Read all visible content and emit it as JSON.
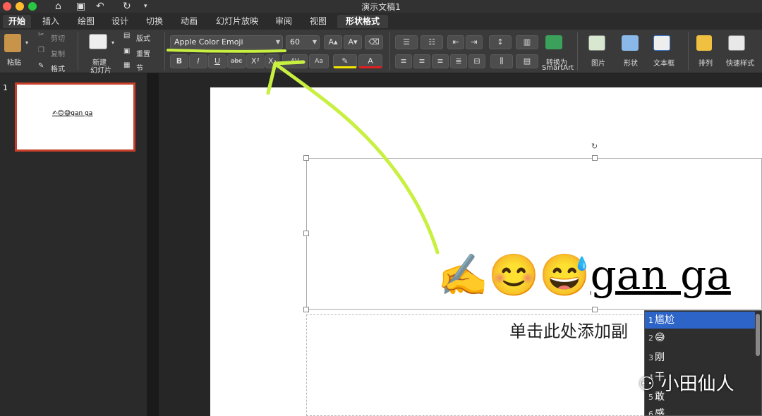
{
  "window": {
    "title": "演示文稿1"
  },
  "tabs": [
    "开始",
    "插入",
    "绘图",
    "设计",
    "切换",
    "动画",
    "幻灯片放映",
    "审阅",
    "视图",
    "形状格式"
  ],
  "ribbon": {
    "paste": "粘贴",
    "cut": "剪切",
    "copy": "复制",
    "format_painter": "格式",
    "new_slide_line1": "新建",
    "new_slide_line2": "幻灯片",
    "layout": "版式",
    "reset": "重置",
    "section": "节",
    "font_name": "Apple Color Emoji",
    "font_size": "60",
    "bold": "B",
    "italic": "I",
    "underline": "U",
    "strike": "abc",
    "superscript": "X²",
    "subscript": "X₂",
    "char_spacing": "AV",
    "change_case": "Aa",
    "font_color_letter": "A",
    "smartart_line1": "转换为",
    "smartart_line2": "SmartArt",
    "picture": "图片",
    "shapes": "形状",
    "textbox": "文本框",
    "arrange": "排列",
    "quick_styles": "快速样式"
  },
  "slides": [
    {
      "number": "1",
      "thumb_text": "✍😊😅gan ga"
    }
  ],
  "slide": {
    "emoji": "✍😊😅",
    "text": "gan    ga",
    "subtitle": "单击此处添加副"
  },
  "ime": {
    "candidates": [
      {
        "n": "1",
        "text": "尴尬"
      },
      {
        "n": "2",
        "text": "😅"
      },
      {
        "n": "3",
        "text": "刚"
      },
      {
        "n": "4",
        "text": "干"
      },
      {
        "n": "5",
        "text": "敢"
      },
      {
        "n": "6",
        "text": "感"
      }
    ]
  },
  "watermark": "小田仙人",
  "colors": {
    "accent_selection": "#2c64c8",
    "annotation": "#c8f040",
    "thumb_border": "#c8402a"
  }
}
